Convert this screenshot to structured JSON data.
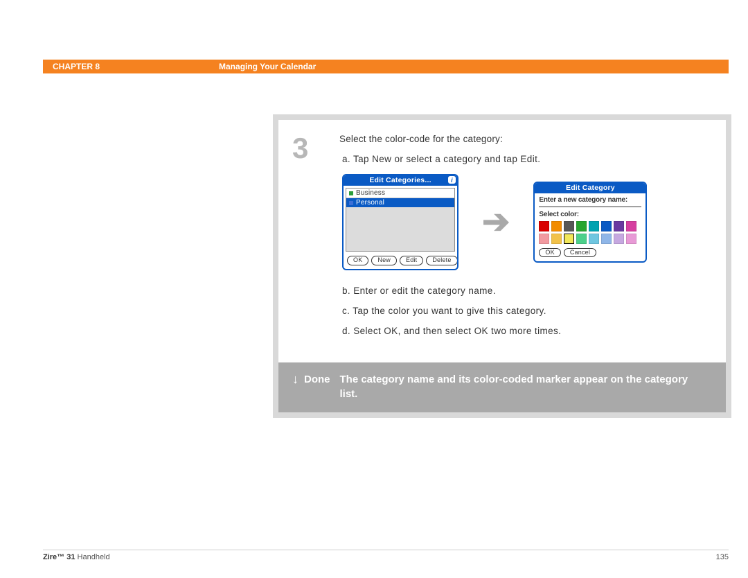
{
  "header": {
    "chapter": "CHAPTER 8",
    "title": "Managing Your Calendar"
  },
  "step": {
    "number": "3",
    "intro": "Select the color-code for the category:",
    "a": "a.  Tap New or select a category and tap Edit.",
    "b": "b.  Enter or edit the category name.",
    "c": "c.  Tap the color you want to give this category.",
    "d": "d.  Select OK, and then select OK two more times."
  },
  "screen1": {
    "title": "Edit Categories...",
    "items": [
      "Business",
      "Personal"
    ],
    "buttons": {
      "ok": "OK",
      "new": "New",
      "edit": "Edit",
      "delete": "Delete"
    }
  },
  "screen2": {
    "title": "Edit Category",
    "enter_label": "Enter a new category name:",
    "select_label": "Select color:",
    "colors_row1": [
      "#d90000",
      "#f28c00",
      "#565656",
      "#26a52e",
      "#00a3b0",
      "#0a5ac4",
      "#6a3aa0",
      "#d63fa0"
    ],
    "colors_row2": [
      "#f29aa0",
      "#f2c24a",
      "#f2e85a",
      "#4cd08a",
      "#6fc6e0",
      "#8fb6e8",
      "#c6a8e0",
      "#e89ad6"
    ],
    "selected_index": 10,
    "ok": "OK",
    "cancel": "Cancel"
  },
  "done": {
    "label": "Done",
    "text": "The category name and its color-coded marker appear on the category list."
  },
  "footer": {
    "product_bold": "Zire™ 31",
    "product_rest": " Handheld",
    "page": "135"
  }
}
